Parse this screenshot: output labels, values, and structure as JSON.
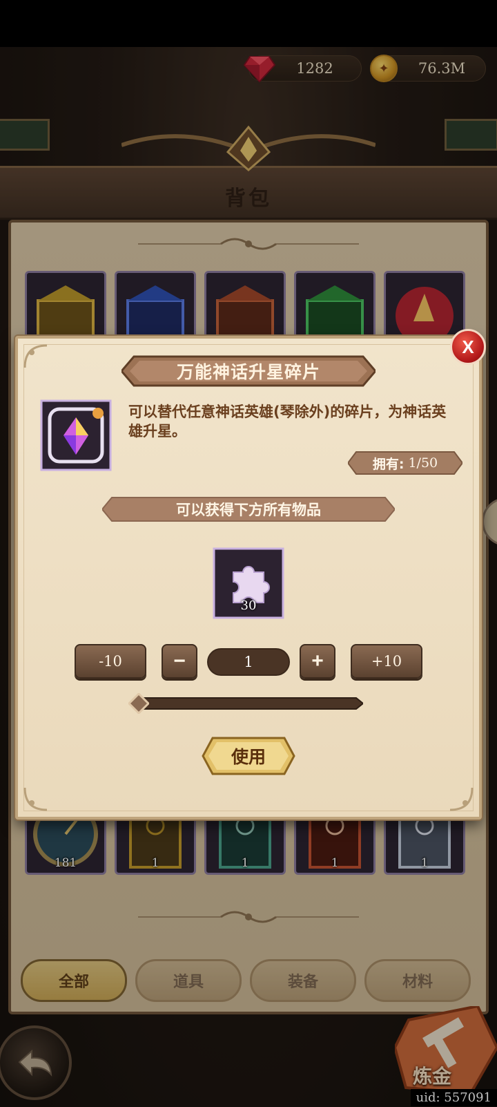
{
  "currencies": {
    "gems": "1282",
    "gold": "76.3M"
  },
  "header": {
    "title": "背包"
  },
  "inventory": {
    "row1": [
      {
        "icon": "gold-chest-icon",
        "color": "#b8962a"
      },
      {
        "icon": "blue-chest-icon",
        "color": "#2e4fb0"
      },
      {
        "icon": "red-chest-icon",
        "color": "#a0472a"
      },
      {
        "icon": "green-chest-icon",
        "color": "#2e8a3a"
      },
      {
        "icon": "red-orb-icon",
        "color": "#b02430"
      }
    ],
    "row2": [
      {
        "icon": "compass-icon",
        "count": "181",
        "color": "#3a6a7a"
      },
      {
        "icon": "gold-tome-icon",
        "count": "1",
        "color": "#8a6a2a"
      },
      {
        "icon": "teal-tome-icon",
        "count": "1",
        "color": "#2a6a5a"
      },
      {
        "icon": "red-tome-icon",
        "count": "1",
        "color": "#8a3020"
      },
      {
        "icon": "silver-tome-icon",
        "count": "1",
        "color": "#8a98b0"
      }
    ]
  },
  "tabs": [
    {
      "label": "全部",
      "active": true
    },
    {
      "label": "道具",
      "active": false
    },
    {
      "label": "装备",
      "active": false
    },
    {
      "label": "材料",
      "active": false
    }
  ],
  "bottom": {
    "alchemy_label": "炼金",
    "uid": "uid: 557091"
  },
  "modal": {
    "close_label": "X",
    "title": "万能神话升星碎片",
    "description": "可以替代任意神话英雄(琴除外)的碎片，为神话英雄升星。",
    "own_label": "拥有:",
    "own_value": "1/50",
    "obtain_label": "可以获得下方所有物品",
    "reward": {
      "icon": "puzzle-piece-icon",
      "count": "30"
    },
    "quantity": {
      "minus10": "-10",
      "minus": "−",
      "value": "1",
      "plus": "+",
      "plus10": "+10"
    },
    "slider_fraction": 0.0,
    "use_label": "使用"
  }
}
